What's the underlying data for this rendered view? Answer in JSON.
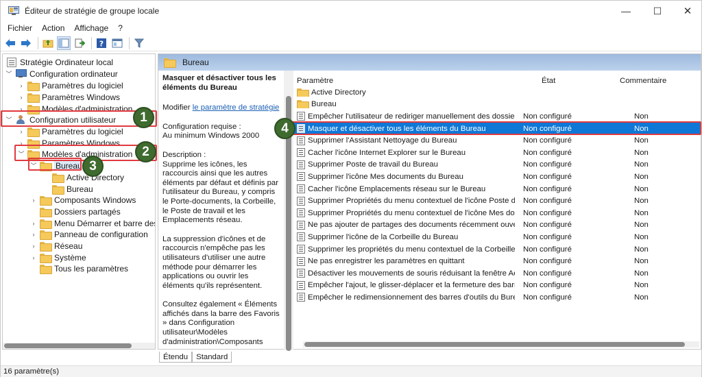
{
  "window": {
    "title": "Éditeur de stratégie de groupe locale"
  },
  "menu": [
    "Fichier",
    "Action",
    "Affichage",
    "?"
  ],
  "tree": {
    "root": "Stratégie Ordinateur local",
    "computer": "Configuration ordinateur",
    "c_software": "Paramètres du logiciel",
    "c_windows": "Paramètres Windows",
    "c_admin": "Modèles d'administration",
    "user": "Configuration utilisateur",
    "u_software": "Paramètres du logiciel",
    "u_windows": "Paramètres Windows",
    "u_admin": "Modèles d'administration",
    "bureau": "Bureau",
    "active_directory": "Active Directory",
    "bureau_sub": "Bureau",
    "components": "Composants Windows",
    "shared_folders": "Dossiers partagés",
    "start_menu": "Menu Démarrer et barre des tâ",
    "control_panel": "Panneau de configuration",
    "network": "Réseau",
    "system": "Système",
    "all_settings": "Tous les paramètres"
  },
  "pane": {
    "header": "Bureau",
    "desc_title": "Masquer et désactiver tous les éléments du Bureau",
    "modify_prefix": "Modifier ",
    "modify_link": "le paramètre de stratégie",
    "requirements": "Configuration requise :",
    "requirements_value": "Au minimum Windows 2000",
    "description_label": "Description :",
    "description_1": "Supprime les icônes, les raccourcis ainsi que les autres éléments par défaut et définis par l'utilisateur du Bureau, y compris le Porte-documents, la Corbeille, le Poste de travail et les Emplacements réseau.",
    "description_2": "La suppression d'icônes et de raccourcis n'empêche pas les utilisateurs d'utiliser une autre méthode pour démarrer les applications ou ouvrir les éléments qu'ils représentent.",
    "description_3": "Consultez également « Éléments affichés dans la barre des Favoris » dans Configuration utilisateur\\Modèles d'administration\\Composants"
  },
  "list": {
    "col_setting": "Paramètre",
    "col_state": "État",
    "col_comment": "Commentaire",
    "folders": [
      "Active Directory",
      "Bureau"
    ],
    "rows": [
      {
        "name": "Empêcher l'utilisateur de rediriger manuellement des dossier...",
        "state": "Non configuré",
        "comment": "Non"
      },
      {
        "name": "Masquer et désactiver tous les éléments du Bureau",
        "state": "Non configuré",
        "comment": "Non"
      },
      {
        "name": "Supprimer l'Assistant Nettoyage du Bureau",
        "state": "Non configuré",
        "comment": "Non"
      },
      {
        "name": "Cacher l'icône Internet Explorer sur le Bureau",
        "state": "Non configuré",
        "comment": "Non"
      },
      {
        "name": "Supprimer Poste de travail du Bureau",
        "state": "Non configuré",
        "comment": "Non"
      },
      {
        "name": "Supprimer l'icône Mes documents du Bureau",
        "state": "Non configuré",
        "comment": "Non"
      },
      {
        "name": "Cacher l'icône Emplacements réseau sur le Bureau",
        "state": "Non configuré",
        "comment": "Non"
      },
      {
        "name": "Supprimer Propriétés du menu contextuel de l'icône Poste de...",
        "state": "Non configuré",
        "comment": "Non"
      },
      {
        "name": "Supprimer Propriétés du menu contextuel de l'icône Mes doc...",
        "state": "Non configuré",
        "comment": "Non"
      },
      {
        "name": "Ne pas ajouter de partages des documents récemment ouver...",
        "state": "Non configuré",
        "comment": "Non"
      },
      {
        "name": "Supprimer l'icône de la Corbeille du Bureau",
        "state": "Non configuré",
        "comment": "Non"
      },
      {
        "name": "Supprimer les propriétés du menu contextuel de la Corbeille",
        "state": "Non configuré",
        "comment": "Non"
      },
      {
        "name": "Ne pas enregistrer les paramètres en quittant",
        "state": "Non configuré",
        "comment": "Non"
      },
      {
        "name": "Désactiver les mouvements de souris réduisant la fenêtre Aer...",
        "state": "Non configuré",
        "comment": "Non"
      },
      {
        "name": "Empêcher l'ajout, le glisser-déplacer et la fermeture des barre...",
        "state": "Non configuré",
        "comment": "Non"
      },
      {
        "name": "Empêcher le redimensionnement des barres d'outils du Bureau",
        "state": "Non configuré",
        "comment": "Non"
      }
    ]
  },
  "tabs": [
    "Étendu",
    "Standard"
  ],
  "status": "16 paramètre(s)",
  "badges": [
    "1",
    "2",
    "3",
    "4"
  ],
  "colors": {
    "selection": "#0f78d7",
    "highlight": "#e0393e",
    "badge": "#3f6b2f",
    "header": "#b3cbe9"
  }
}
